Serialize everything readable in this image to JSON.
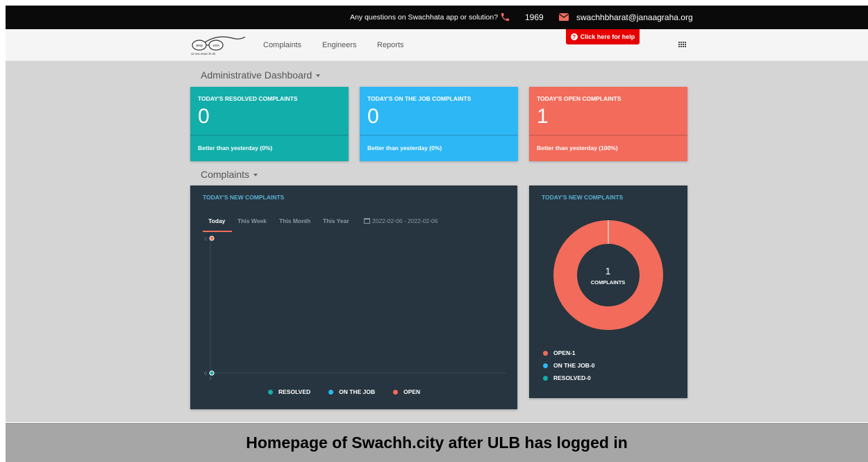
{
  "topbar": {
    "question": "Any questions on Swachhata app or solution?",
    "phone": "1969",
    "email": "swachhbharat@janaagraha.org"
  },
  "navbar": {
    "logo_text_left": "स्वच्छ",
    "logo_text_right": "भारत",
    "logo_tagline": "एक कदम स्वच्छता की ओर",
    "links": [
      "Complaints",
      "Engineers",
      "Reports"
    ],
    "help_button": "Click here for help"
  },
  "sections": {
    "dashboard_title": "Administrative Dashboard",
    "complaints_title": "Complaints"
  },
  "stat_cards": [
    {
      "label": "TODAY'S RESOLVED COMPLAINTS",
      "value": "0",
      "footer": "Better than yesterday (0%)",
      "color": "#12aeaa"
    },
    {
      "label": "TODAY'S ON THE JOB COMPLAINTS",
      "value": "0",
      "footer": "Better than yesterday (0%)",
      "color": "#2db7f5"
    },
    {
      "label": "TODAY'S OPEN COMPLAINTS",
      "value": "1",
      "footer": "Better than yesterday (100%)",
      "color": "#f26b5b"
    }
  ],
  "line_panel": {
    "title": "TODAY'S NEW COMPLAINTS",
    "tabs": [
      "Today",
      "This Week",
      "This Month",
      "This Year"
    ],
    "active_tab": "Today",
    "date_range": "2022-02-06 - 2022-02-06",
    "legend": [
      {
        "name": "RESOLVED",
        "color": "#12aeaa"
      },
      {
        "name": "ON THE JOB",
        "color": "#2db7f5"
      },
      {
        "name": "OPEN",
        "color": "#f26b5b"
      }
    ],
    "y_labels": [
      "1",
      "0"
    ],
    "x_label": "7"
  },
  "donut_panel": {
    "title": "TODAY'S NEW COMPLAINTS",
    "center_value": "1",
    "center_label": "COMPLAINTS",
    "legend": [
      {
        "name": "OPEN-1",
        "color": "#f26b5b"
      },
      {
        "name": "ON THE JOB-0",
        "color": "#2db7f5"
      },
      {
        "name": "RESOLVED-0",
        "color": "#12aeaa"
      }
    ]
  },
  "chart_data": [
    {
      "type": "line",
      "title": "TODAY'S NEW COMPLAINTS",
      "ylim": [
        0,
        1
      ],
      "series": [
        {
          "name": "OPEN",
          "values": [
            1
          ]
        },
        {
          "name": "ON THE JOB",
          "values": [
            0
          ]
        },
        {
          "name": "RESOLVED",
          "values": [
            0
          ]
        }
      ]
    },
    {
      "type": "pie",
      "title": "TODAY'S NEW COMPLAINTS",
      "categories": [
        "OPEN",
        "ON THE JOB",
        "RESOLVED"
      ],
      "values": [
        1,
        0,
        0
      ]
    }
  ],
  "caption": "Homepage of Swachh.city after ULB has logged in"
}
